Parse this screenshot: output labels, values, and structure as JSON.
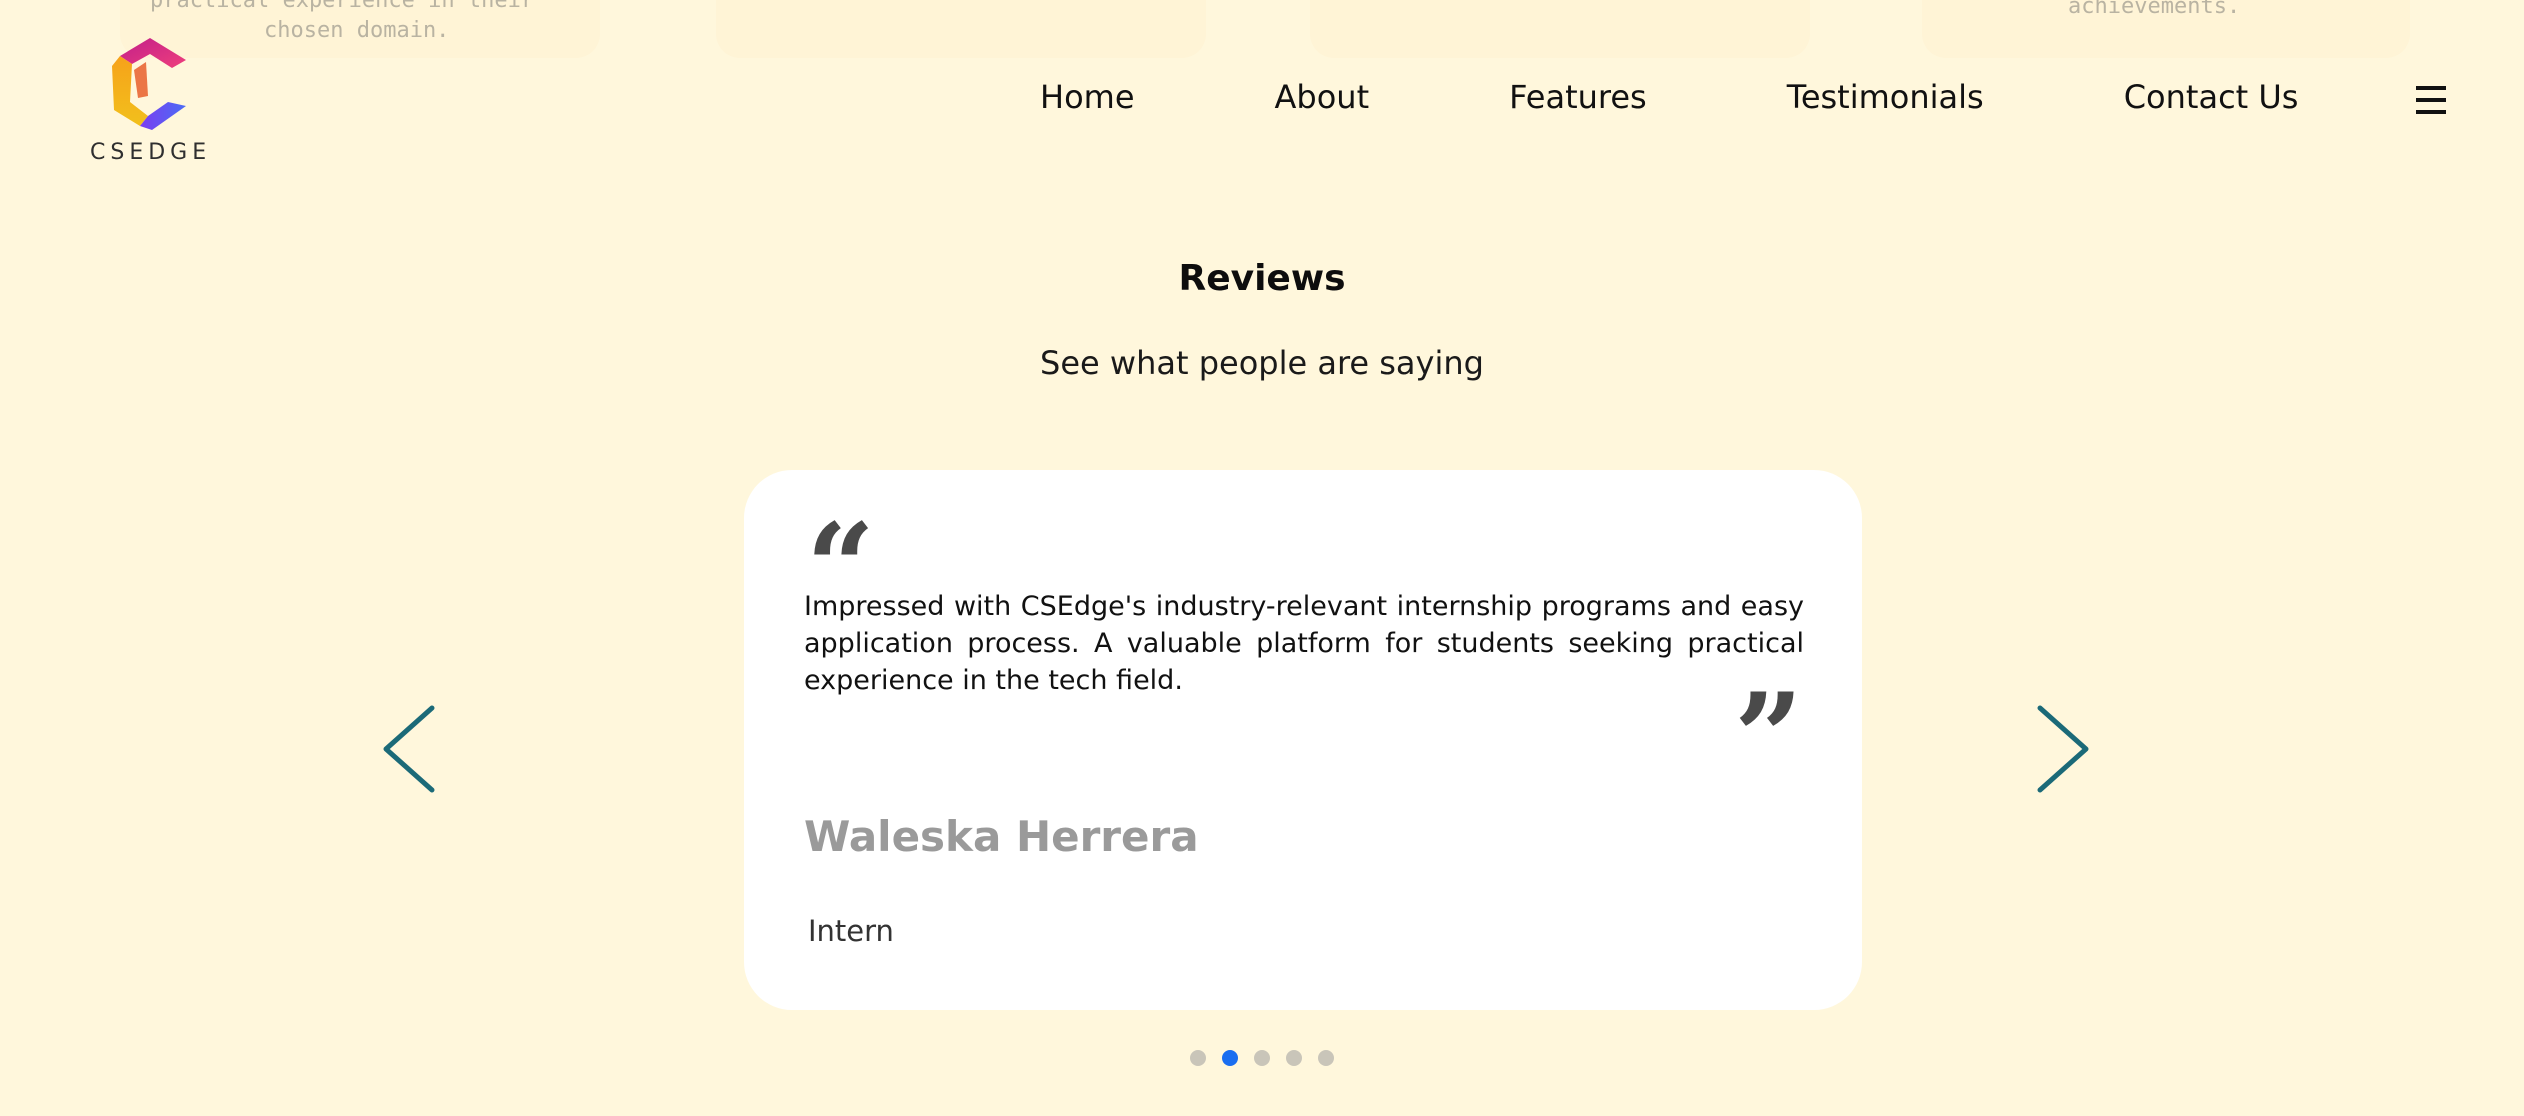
{
  "background_cards": {
    "card1_text_line1": "practical experience in their",
    "card1_text_line2": "chosen domain.",
    "card4_text": "achievements."
  },
  "header": {
    "logo_text": "CSEDGE",
    "nav": [
      "Home",
      "About",
      "Features",
      "Testimonials",
      "Contact Us"
    ],
    "menu_icon": "hamburger-menu-icon"
  },
  "reviews": {
    "title": "Reviews",
    "subtitle": "See what people are saying",
    "current": {
      "text": "Impressed with CSEdge's industry-relevant internship programs and easy application process. A valuable platform for students seeking practical experience in the tech field.",
      "name": "Waleska Herrera",
      "role": "Intern"
    },
    "dots_count": 5,
    "active_dot": 2
  },
  "colors": {
    "background": "#fff7dc",
    "arrow": "#1b6a78",
    "dot_active": "#1a6ef0",
    "dot_inactive": "#c9c5b9"
  }
}
